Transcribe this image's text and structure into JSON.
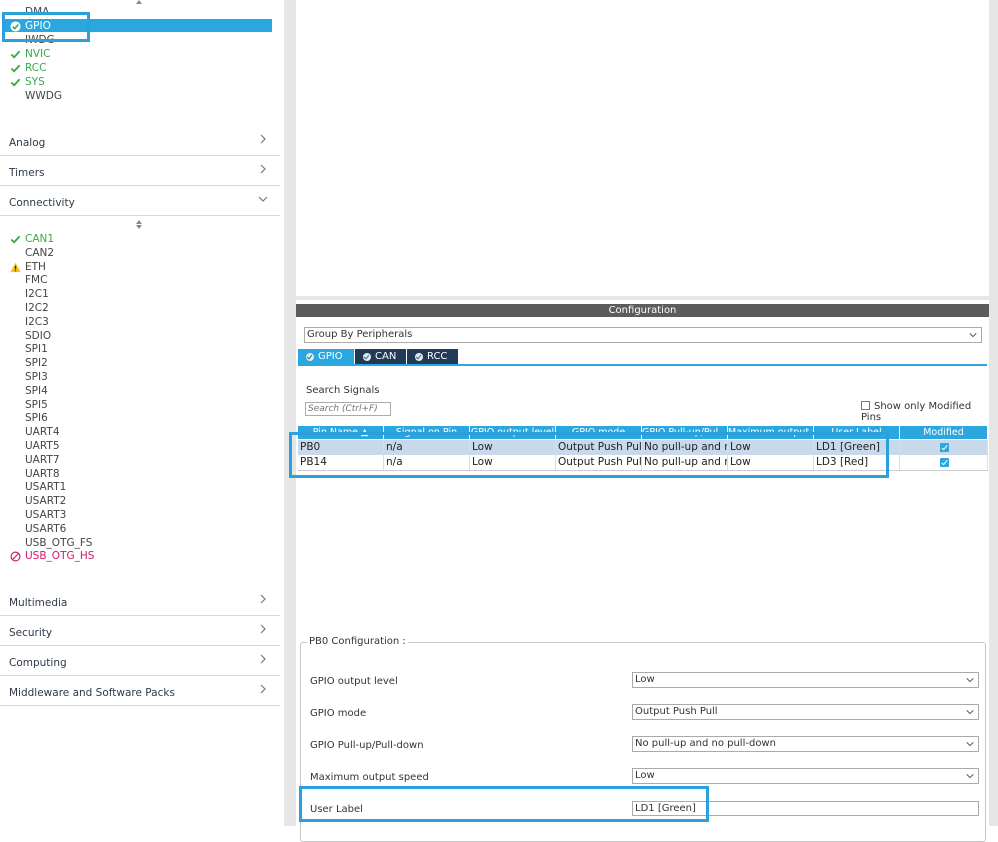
{
  "sidebar": {
    "system_core_items": [
      {
        "label": "DMA",
        "status": "none"
      },
      {
        "label": "GPIO",
        "status": "ok",
        "selected": true
      },
      {
        "label": "IWDG",
        "status": "none"
      },
      {
        "label": "NVIC",
        "status": "ok"
      },
      {
        "label": "RCC",
        "status": "ok"
      },
      {
        "label": "SYS",
        "status": "ok"
      },
      {
        "label": "WWDG",
        "status": "none"
      }
    ],
    "sections": {
      "analog": "Analog",
      "timers": "Timers",
      "connectivity": "Connectivity",
      "multimedia": "Multimedia",
      "security": "Security",
      "computing": "Computing",
      "middleware": "Middleware and Software Packs"
    },
    "connectivity_items": [
      {
        "label": "CAN1",
        "status": "ok"
      },
      {
        "label": "CAN2",
        "status": "none"
      },
      {
        "label": "ETH",
        "status": "warning"
      },
      {
        "label": "FMC",
        "status": "none"
      },
      {
        "label": "I2C1",
        "status": "none"
      },
      {
        "label": "I2C2",
        "status": "none"
      },
      {
        "label": "I2C3",
        "status": "none"
      },
      {
        "label": "SDIO",
        "status": "none"
      },
      {
        "label": "SPI1",
        "status": "none"
      },
      {
        "label": "SPI2",
        "status": "none"
      },
      {
        "label": "SPI3",
        "status": "none"
      },
      {
        "label": "SPI4",
        "status": "none"
      },
      {
        "label": "SPI5",
        "status": "none"
      },
      {
        "label": "SPI6",
        "status": "none"
      },
      {
        "label": "UART4",
        "status": "none"
      },
      {
        "label": "UART5",
        "status": "none"
      },
      {
        "label": "UART7",
        "status": "none"
      },
      {
        "label": "UART8",
        "status": "none"
      },
      {
        "label": "USART1",
        "status": "none"
      },
      {
        "label": "USART2",
        "status": "none"
      },
      {
        "label": "USART3",
        "status": "none"
      },
      {
        "label": "USART6",
        "status": "none"
      },
      {
        "label": "USB_OTG_FS",
        "status": "none"
      },
      {
        "label": "USB_OTG_HS",
        "status": "disabled"
      }
    ]
  },
  "configuration": {
    "title": "Configuration",
    "group_by": "Group By Peripherals",
    "tabs": [
      "GPIO",
      "CAN",
      "RCC"
    ],
    "search_label": "Search Signals",
    "search_placeholder": "Search (Ctrl+F)",
    "show_modified_label": "Show only Modified Pins",
    "table": {
      "columns": [
        "Pin Name",
        "Signal on Pin",
        "GPIO output level",
        "GPIO mode",
        "GPIO Pull-up/Pul...",
        "Maximum output ...",
        "User Label",
        "Modified"
      ],
      "rows": [
        {
          "pin": "PB0",
          "signal": "n/a",
          "level": "Low",
          "mode": "Output Push Pull",
          "pull": "No pull-up and n...",
          "speed": "Low",
          "label": "LD1 [Green]",
          "modified": true
        },
        {
          "pin": "PB14",
          "signal": "n/a",
          "level": "Low",
          "mode": "Output Push Pull",
          "pull": "No pull-up and n...",
          "speed": "Low",
          "label": "LD3 [Red]",
          "modified": true
        }
      ]
    },
    "pin_config": {
      "title": "PB0 Configuration :",
      "fields": [
        {
          "label": "GPIO output level",
          "value": "Low"
        },
        {
          "label": "GPIO mode",
          "value": "Output Push Pull"
        },
        {
          "label": "GPIO Pull-up/Pull-down",
          "value": "No pull-up and no pull-down"
        },
        {
          "label": "Maximum output speed",
          "value": "Low"
        }
      ],
      "user_label": {
        "label": "User Label",
        "value": "LD1 [Green]"
      }
    }
  },
  "colors": {
    "accent": "#2ba7df",
    "ok": "#3aa84a",
    "error": "#d4166e",
    "warning": "#f3c300",
    "header_bar": "#5c5c5c",
    "highlight_box": "#2aa0dc"
  }
}
